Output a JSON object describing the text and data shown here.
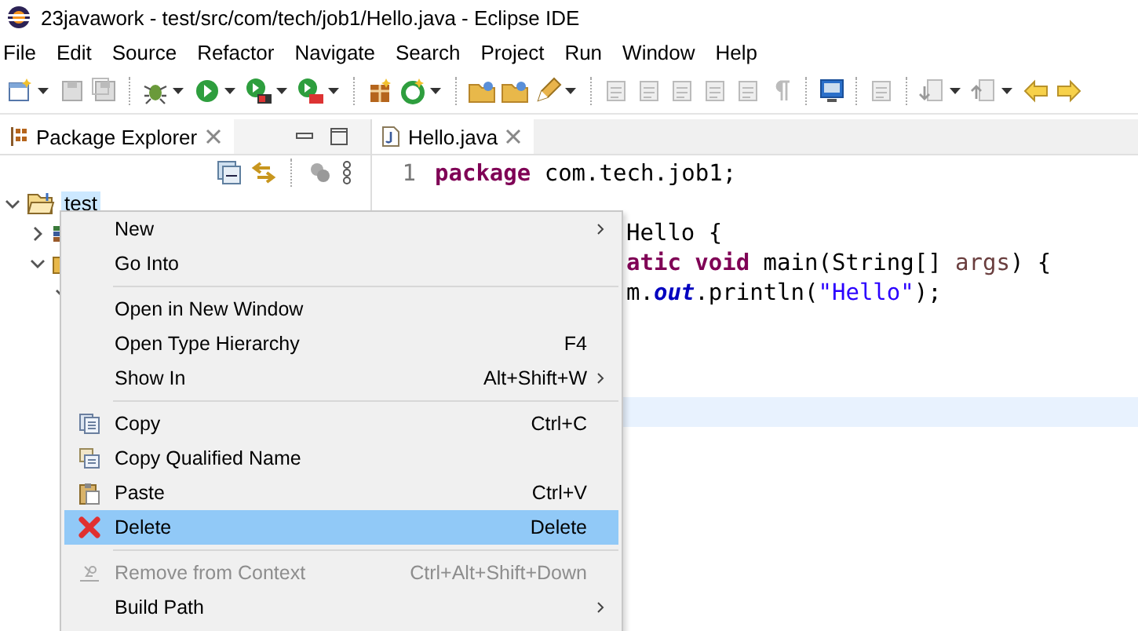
{
  "window": {
    "title": "23javawork - test/src/com/tech/job1/Hello.java - Eclipse IDE"
  },
  "menu_bar": [
    "File",
    "Edit",
    "Source",
    "Refactor",
    "Navigate",
    "Search",
    "Project",
    "Run",
    "Window",
    "Help"
  ],
  "package_explorer": {
    "title": "Package Explorer",
    "tree": [
      {
        "label": "test",
        "selected": true,
        "expanded": true,
        "children": [
          {
            "kind": "library",
            "expanded": false
          },
          {
            "kind": "source-folder",
            "expanded": true,
            "children": [
              {
                "expanded": true
              }
            ]
          }
        ]
      }
    ]
  },
  "editor": {
    "tab": "Hello.java",
    "lines": [
      {
        "number": "1",
        "kind": "code",
        "tokens": [
          {
            "kind": "keyword",
            "text": "package"
          },
          {
            "kind": "plain",
            "text": " com.tech.job1;"
          }
        ]
      },
      {
        "kind": "blank"
      },
      {
        "kind": "behind-menu",
        "tokens": [
          {
            "kind": "plain",
            "text": "Hello {"
          }
        ]
      },
      {
        "kind": "behind-menu",
        "tokens": [
          {
            "kind": "keyword",
            "text": "atic"
          },
          {
            "kind": "keyword",
            "text": " void"
          },
          {
            "kind": "plain",
            "text": " main(String[] "
          },
          {
            "kind": "param",
            "text": "args"
          },
          {
            "kind": "plain",
            "text": ") {"
          }
        ]
      },
      {
        "kind": "behind-menu",
        "tokens": [
          {
            "kind": "plain",
            "text": "m."
          },
          {
            "kind": "field",
            "text": "out"
          },
          {
            "kind": "plain",
            "text": ".println("
          },
          {
            "kind": "string",
            "text": "\"Hello\""
          },
          {
            "kind": "plain",
            "text": ");"
          }
        ]
      },
      {
        "kind": "blank"
      },
      {
        "kind": "blank"
      },
      {
        "kind": "blank"
      },
      {
        "kind": "current"
      }
    ]
  },
  "context_menu": [
    {
      "kind": "item",
      "label": "New",
      "submenu": true,
      "selected": false,
      "disabled": false
    },
    {
      "kind": "item",
      "label": "Go Into",
      "submenu": false,
      "selected": false,
      "disabled": false
    },
    {
      "kind": "separator"
    },
    {
      "kind": "item",
      "label": "Open in New Window",
      "submenu": false,
      "selected": false,
      "disabled": false
    },
    {
      "kind": "item",
      "label": "Open Type Hierarchy",
      "shortcut": "F4",
      "submenu": false,
      "selected": false,
      "disabled": false
    },
    {
      "kind": "item",
      "label": "Show In",
      "shortcut": "Alt+Shift+W",
      "submenu": true,
      "selected": false,
      "disabled": false
    },
    {
      "kind": "separator"
    },
    {
      "kind": "item",
      "label": "Copy",
      "shortcut": "Ctrl+C",
      "submenu": false,
      "selected": false,
      "disabled": false
    },
    {
      "kind": "item",
      "label": "Copy Qualified Name",
      "submenu": false,
      "selected": false,
      "disabled": false
    },
    {
      "kind": "item",
      "label": "Paste",
      "shortcut": "Ctrl+V",
      "submenu": false,
      "selected": false,
      "disabled": false
    },
    {
      "kind": "item",
      "label": "Delete",
      "shortcut": "Delete",
      "submenu": false,
      "selected": true,
      "disabled": false
    },
    {
      "kind": "separator"
    },
    {
      "kind": "item",
      "label": "Remove from Context",
      "shortcut": "Ctrl+Alt+Shift+Down",
      "submenu": false,
      "selected": false,
      "disabled": true
    },
    {
      "kind": "item",
      "label": "Build Path",
      "submenu": true,
      "selected": false,
      "disabled": false
    }
  ]
}
